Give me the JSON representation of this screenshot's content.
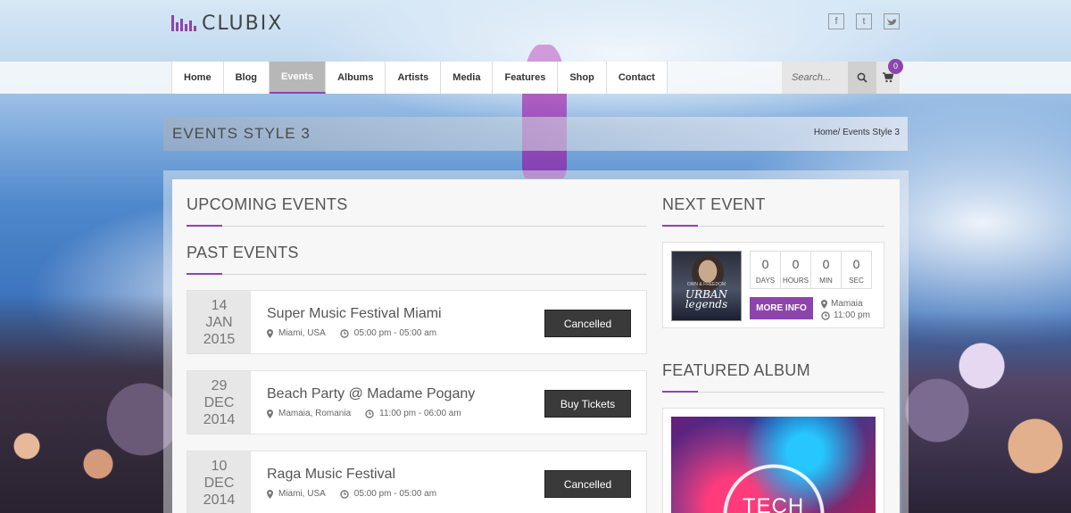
{
  "brand": {
    "name": "CLUBIX",
    "accent": "#8e44ad"
  },
  "social": [
    {
      "icon": "facebook-icon",
      "glyph": "f"
    },
    {
      "icon": "tumblr-icon",
      "glyph": "t"
    },
    {
      "icon": "twitter-icon",
      "glyph": "t"
    }
  ],
  "nav": {
    "items": [
      {
        "label": "Home",
        "active": false
      },
      {
        "label": "Blog",
        "active": false
      },
      {
        "label": "Events",
        "active": true
      },
      {
        "label": "Albums",
        "active": false
      },
      {
        "label": "Artists",
        "active": false
      },
      {
        "label": "Media",
        "active": false
      },
      {
        "label": "Features",
        "active": false
      },
      {
        "label": "Shop",
        "active": false
      },
      {
        "label": "Contact",
        "active": false
      }
    ],
    "search_placeholder": "Search...",
    "cart_count": "0"
  },
  "page": {
    "title": "EVENTS STYLE 3",
    "breadcrumb": "Home/ Events Style 3"
  },
  "sections": {
    "upcoming": "UPCOMING EVENTS",
    "past": "PAST EVENTS",
    "next": "NEXT EVENT",
    "featured": "FEATURED ALBUM"
  },
  "events": [
    {
      "day": "14",
      "month": "JAN",
      "year": "2015",
      "title": "Super Music Festival Miami",
      "location": "Miami, USA",
      "time": "05:00 pm - 05:00 am",
      "button": "Cancelled"
    },
    {
      "day": "29",
      "month": "DEC",
      "year": "2014",
      "title": "Beach Party @ Madame Pogany",
      "location": "Mamaia, Romania",
      "time": "11:00 pm - 06:00 am",
      "button": "Buy Tickets"
    },
    {
      "day": "10",
      "month": "DEC",
      "year": "2014",
      "title": "Raga Music Festival",
      "location": "Miami, USA",
      "time": "05:00 pm - 05:00 am",
      "button": "Cancelled"
    }
  ],
  "next_event": {
    "cover_line1": "OWN & FREEDOM",
    "cover_title": "URBAN legends",
    "countdown": [
      {
        "value": "0",
        "label": "DAYS"
      },
      {
        "value": "0",
        "label": "HOURS"
      },
      {
        "value": "0",
        "label": "MIN"
      },
      {
        "value": "0",
        "label": "SEC"
      }
    ],
    "button": "MORE INFO",
    "location": "Mamaia",
    "time": "11:00 pm"
  },
  "album": {
    "cover_text": "TECH"
  }
}
